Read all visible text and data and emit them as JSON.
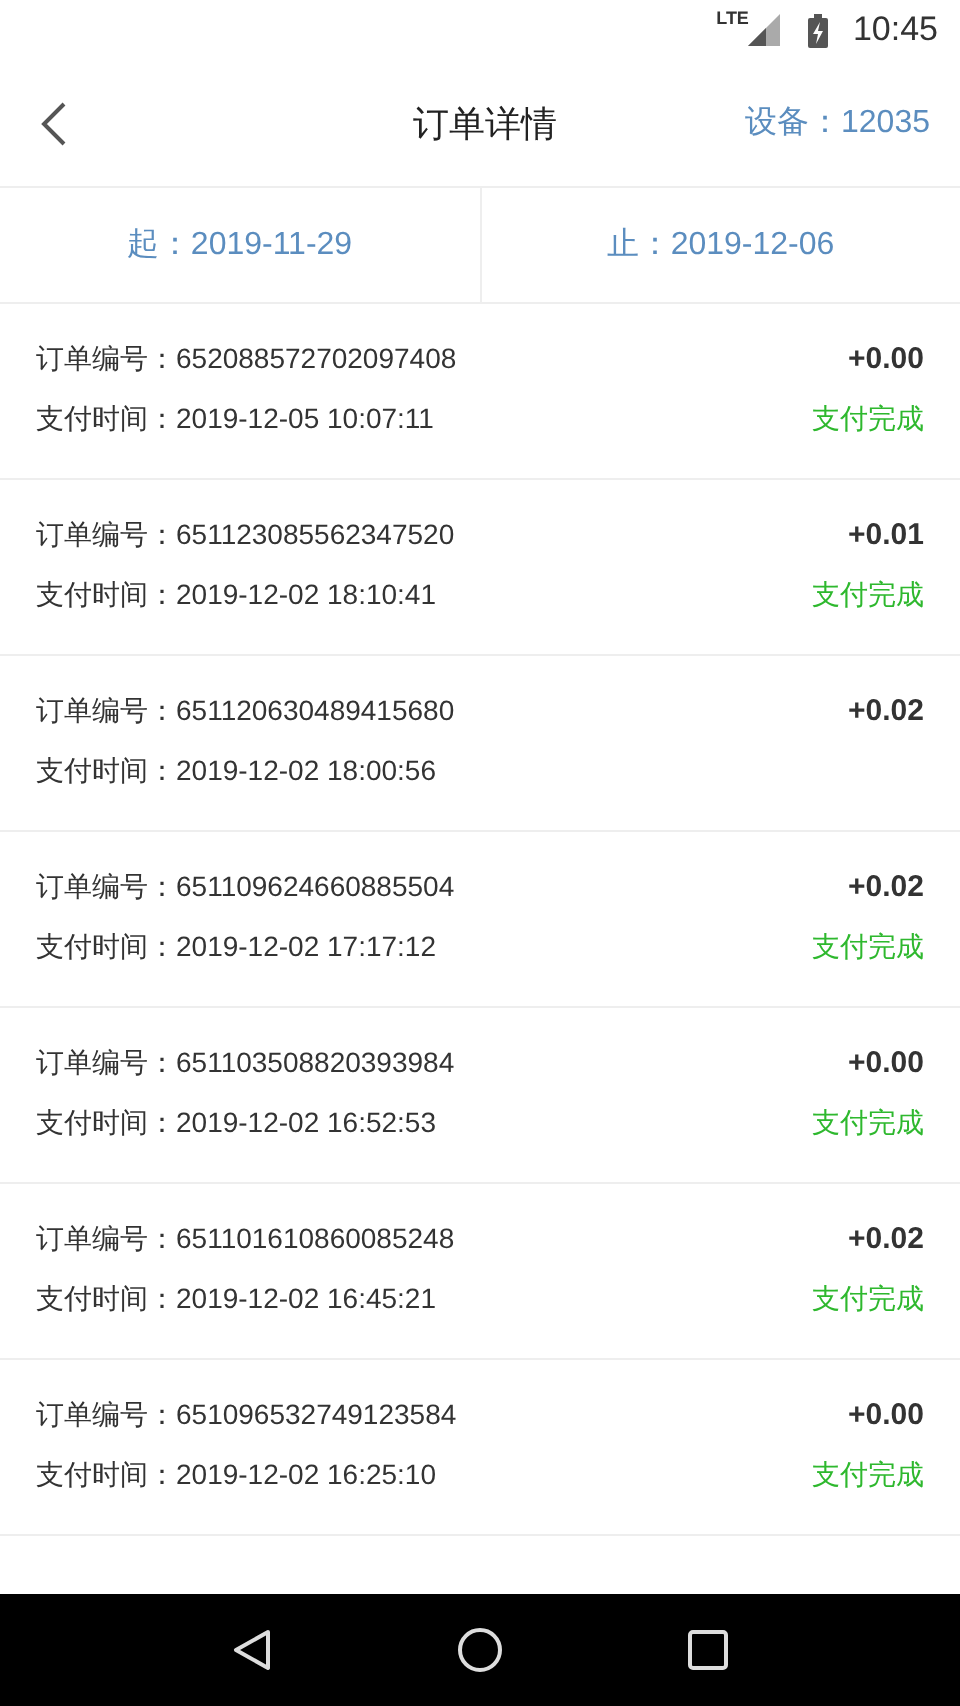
{
  "status_bar": {
    "network": "LTE",
    "time": "10:45"
  },
  "header": {
    "title": "订单详情",
    "device": "设备：12035"
  },
  "date_range": {
    "start": "起：2019-11-29",
    "end": "止：2019-12-06"
  },
  "orders": [
    {
      "order_no": "订单编号：652088572702097408",
      "pay_time": "支付时间：2019-12-05 10:07:11",
      "amount": "+0.00",
      "status": "支付完成"
    },
    {
      "order_no": "订单编号：651123085562347520",
      "pay_time": "支付时间：2019-12-02 18:10:41",
      "amount": "+0.01",
      "status": "支付完成"
    },
    {
      "order_no": "订单编号：651120630489415680",
      "pay_time": "支付时间：2019-12-02 18:00:56",
      "amount": "+0.02"
    },
    {
      "order_no": "订单编号：651109624660885504",
      "pay_time": "支付时间：2019-12-02 17:17:12",
      "amount": "+0.02",
      "status": "支付完成"
    },
    {
      "order_no": "订单编号：651103508820393984",
      "pay_time": "支付时间：2019-12-02 16:52:53",
      "amount": "+0.00",
      "status": "支付完成"
    },
    {
      "order_no": "订单编号：651101610860085248",
      "pay_time": "支付时间：2019-12-02 16:45:21",
      "amount": "+0.02",
      "status": "支付完成"
    },
    {
      "order_no": "订单编号：651096532749123584",
      "pay_time": "支付时间：2019-12-02 16:25:10",
      "amount": "+0.00",
      "status": "支付完成"
    }
  ]
}
